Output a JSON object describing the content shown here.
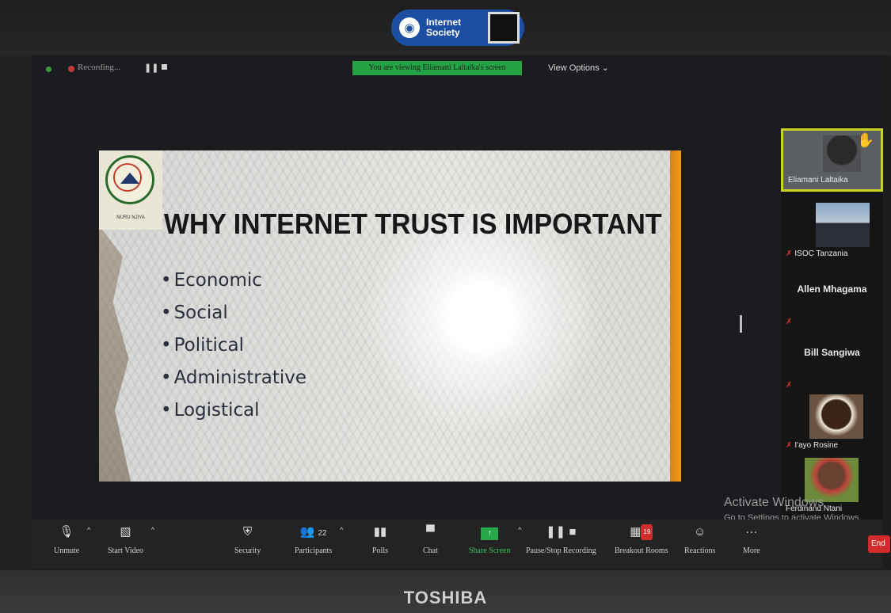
{
  "device": {
    "brand": "TOSHIBA",
    "sticker": "Internet Society"
  },
  "topbar": {
    "recording": "Recording...",
    "pause_icon": "pause-icon",
    "stop_icon": "stop-icon",
    "viewing_banner": "You are viewing Eliamani Laltaika's screen",
    "view_options": "View Options ⌄",
    "banner_color": "#23a343"
  },
  "slide": {
    "title": "WHY INTERNET TRUST IS IMPORTANT",
    "logo_text": "NURU NJIYA",
    "bullets": [
      "Economic",
      "Social",
      "Political",
      "Administrative",
      "Logistical"
    ],
    "accent_color": "#f09a20"
  },
  "participants": [
    {
      "name": "Eliamani Laltaika",
      "active": true,
      "raised_hand": true
    },
    {
      "name": "ISOC Tanzania",
      "muted": true
    },
    {
      "name": "Allen Mhagama",
      "muted": true
    },
    {
      "name": "Bill Sangiwa",
      "muted": true
    },
    {
      "name": "I'ayo Rosine",
      "muted": true
    },
    {
      "name": "Ferdinand Ntani"
    }
  ],
  "watermark": {
    "line1": "Activate Windows",
    "line2": "Go to Settings to activate Windows."
  },
  "toolbar": {
    "unmute": "Unmute",
    "start_video": "Start Video",
    "security": "Security",
    "participants": "Participants",
    "participants_count": "22",
    "polls": "Polls",
    "chat": "Chat",
    "share_screen": "Share Screen",
    "recording": "Pause/Stop Recording",
    "breakout": "Breakout Rooms",
    "breakout_badge": "19",
    "reactions": "Reactions",
    "more": "More",
    "end": "End"
  }
}
